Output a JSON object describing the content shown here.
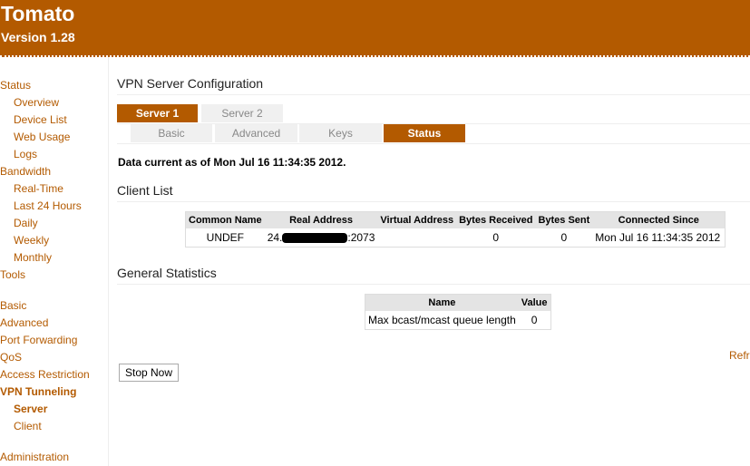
{
  "app": {
    "title": "Tomato",
    "version": "Version 1.28"
  },
  "sidebar": [
    {
      "label": "Status",
      "lvl": "top"
    },
    {
      "label": "Overview",
      "lvl": "sub"
    },
    {
      "label": "Device List",
      "lvl": "sub"
    },
    {
      "label": "Web Usage",
      "lvl": "sub"
    },
    {
      "label": "Logs",
      "lvl": "sub"
    },
    {
      "label": "Bandwidth",
      "lvl": "top"
    },
    {
      "label": "Real-Time",
      "lvl": "sub"
    },
    {
      "label": "Last 24 Hours",
      "lvl": "sub"
    },
    {
      "label": "Daily",
      "lvl": "sub"
    },
    {
      "label": "Weekly",
      "lvl": "sub"
    },
    {
      "label": "Monthly",
      "lvl": "sub"
    },
    {
      "label": "Tools",
      "lvl": "top"
    },
    {
      "label": "Basic",
      "lvl": "top"
    },
    {
      "label": "Advanced",
      "lvl": "top"
    },
    {
      "label": "Port Forwarding",
      "lvl": "top"
    },
    {
      "label": "QoS",
      "lvl": "top"
    },
    {
      "label": "Access Restriction",
      "lvl": "top"
    },
    {
      "label": "VPN Tunneling",
      "lvl": "top b"
    },
    {
      "label": "Server",
      "lvl": "sub b"
    },
    {
      "label": "Client",
      "lvl": "sub"
    },
    {
      "label": "Administration",
      "lvl": "top"
    }
  ],
  "main": {
    "title": "VPN Server Configuration",
    "server_tabs": [
      "Server 1",
      "Server 2"
    ],
    "sub_tabs": [
      "Basic",
      "Advanced",
      "Keys",
      "Status"
    ],
    "data_current": "Data current as of Mon Jul 16 11:34:35 2012.",
    "client_list": {
      "title": "Client List",
      "headers": [
        "Common Name",
        "Real Address",
        "Virtual Address",
        "Bytes Received",
        "Bytes Sent",
        "Connected Since"
      ],
      "row": {
        "common_name": "UNDEF",
        "real_prefix": "24.",
        "real_suffix": ":2073",
        "virtual": "",
        "bytes_received": "0",
        "bytes_sent": "0",
        "connected_since": "Mon Jul 16 11:34:35 2012"
      }
    },
    "general": {
      "title": "General Statistics",
      "headers": [
        "Name",
        "Value"
      ],
      "row": {
        "name": "Max bcast/mcast queue length",
        "value": "0"
      }
    },
    "refresh": "Refr",
    "stop_button": "Stop Now"
  }
}
